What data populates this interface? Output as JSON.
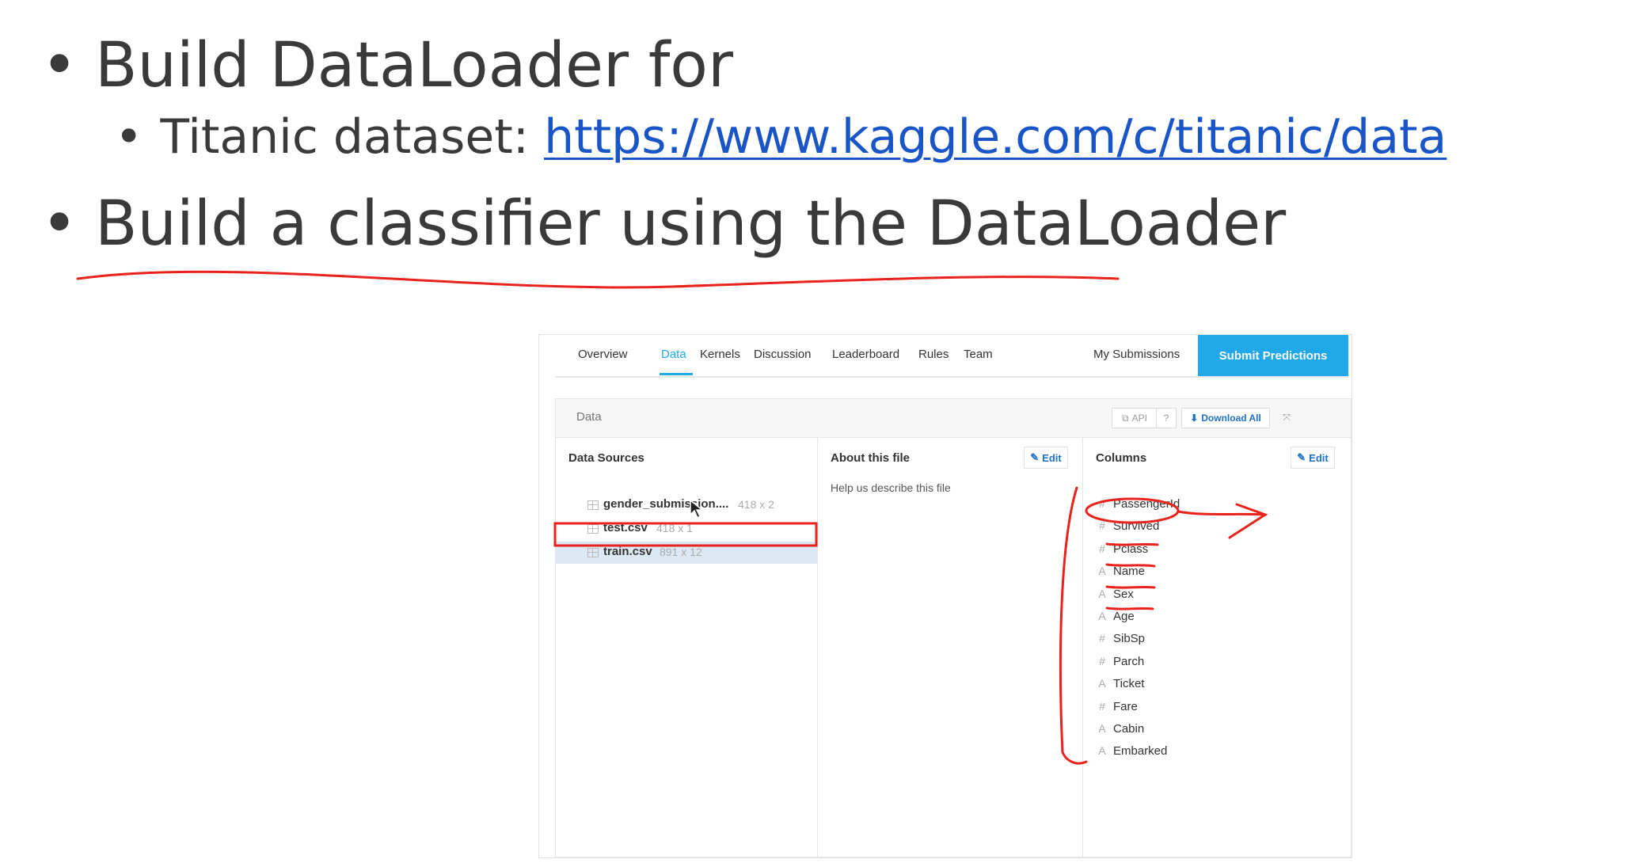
{
  "slide": {
    "bullets": [
      {
        "marker": "•",
        "text": "Build DataLoader for"
      },
      {
        "marker": "•",
        "prefix": "Titanic dataset: ",
        "link": "https://www.kaggle.com/c/titanic/data"
      },
      {
        "marker": "•",
        "text": "Build a classifier using the DataLoader"
      }
    ]
  },
  "kaggle": {
    "nav": {
      "tabs": [
        "Overview",
        "Data",
        "Kernels",
        "Discussion",
        "Leaderboard",
        "Rules",
        "Team"
      ],
      "active_tab": "Data",
      "my_submissions": "My Submissions",
      "submit": "Submit Predictions"
    },
    "panel": {
      "title": "Data",
      "api_label": "API",
      "help_label": "?",
      "download_label": "Download All",
      "expand_icon": "expand-icon"
    },
    "data_sources": {
      "title": "Data Sources",
      "files": [
        {
          "name": "gender_submission....",
          "size": "418 x 2"
        },
        {
          "name": "test.csv",
          "size": "418 x 1"
        },
        {
          "name": "train.csv",
          "size": "891 x 12",
          "selected": true
        }
      ]
    },
    "about": {
      "title": "About this file",
      "edit_label": "Edit",
      "description": "Help us describe this file"
    },
    "columns": {
      "title": "Columns",
      "edit_label": "Edit",
      "items": [
        {
          "type": "#",
          "name": "PassengerId"
        },
        {
          "type": "#",
          "name": "Survived"
        },
        {
          "type": "#",
          "name": "Pclass"
        },
        {
          "type": "A",
          "name": "Name"
        },
        {
          "type": "A",
          "name": "Sex"
        },
        {
          "type": "A",
          "name": "Age"
        },
        {
          "type": "#",
          "name": "SibSp"
        },
        {
          "type": "#",
          "name": "Parch"
        },
        {
          "type": "A",
          "name": "Ticket"
        },
        {
          "type": "#",
          "name": "Fare"
        },
        {
          "type": "A",
          "name": "Cabin"
        },
        {
          "type": "A",
          "name": "Embarked"
        }
      ]
    }
  },
  "colors": {
    "accent": "#20a8e8",
    "link": "#1a55c8",
    "annotation": "#e8231c",
    "selection": "#dde8f5"
  }
}
